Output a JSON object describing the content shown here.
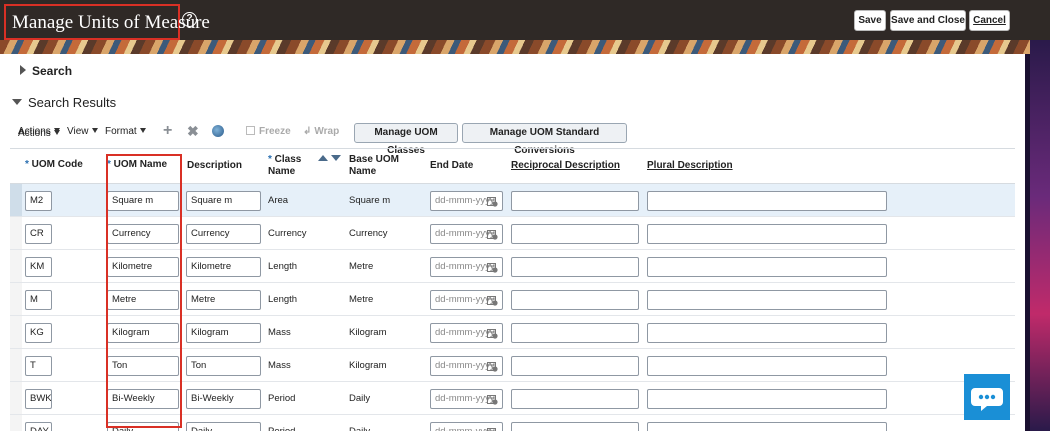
{
  "header": {
    "title": "Manage Units of Measure",
    "help_icon": "?",
    "save": "Save",
    "save_close": "Save and Close",
    "cancel": "Cancel"
  },
  "search": {
    "label": "Search"
  },
  "results": {
    "label": "Search Results"
  },
  "toolbar": {
    "actions": "Actions",
    "view": "View",
    "format": "Format",
    "freeze": "Freeze",
    "wrap": "Wrap",
    "manage_classes": "Manage UOM Classes",
    "manage_conversions": "Manage UOM Standard Conversions"
  },
  "columns": {
    "code": "UOM Code",
    "name": "UOM Name",
    "description": "Description",
    "class_line1": "Class",
    "class_line2": "Name",
    "base_line1": "Base UOM",
    "base_line2": "Name",
    "end_date": "End Date",
    "reciprocal": "Reciprocal Description",
    "plural": "Plural Description"
  },
  "date_placeholder": "dd-mmm-yyyy",
  "rows": [
    {
      "code": "M2",
      "name": "Square m",
      "description": "Square m",
      "class": "Area",
      "base": "Square m"
    },
    {
      "code": "CR",
      "name": "Currency",
      "description": "Currency",
      "class": "Currency",
      "base": "Currency"
    },
    {
      "code": "KM",
      "name": "Kilometre",
      "description": "Kilometre",
      "class": "Length",
      "base": "Metre"
    },
    {
      "code": "M",
      "name": "Metre",
      "description": "Metre",
      "class": "Length",
      "base": "Metre"
    },
    {
      "code": "KG",
      "name": "Kilogram",
      "description": "Kilogram",
      "class": "Mass",
      "base": "Kilogram"
    },
    {
      "code": "T",
      "name": "Ton",
      "description": "Ton",
      "class": "Mass",
      "base": "Kilogram"
    },
    {
      "code": "BWK",
      "name": "Bi-Weekly",
      "description": "Bi-Weekly",
      "class": "Period",
      "base": "Daily"
    },
    {
      "code": "DAY",
      "name": "Daily",
      "description": "Daily",
      "class": "Period",
      "base": "Daily"
    }
  ],
  "colors": {
    "accent_red": "#d93025",
    "chat_blue": "#1a8fd6",
    "header_bg": "#2f2926"
  }
}
